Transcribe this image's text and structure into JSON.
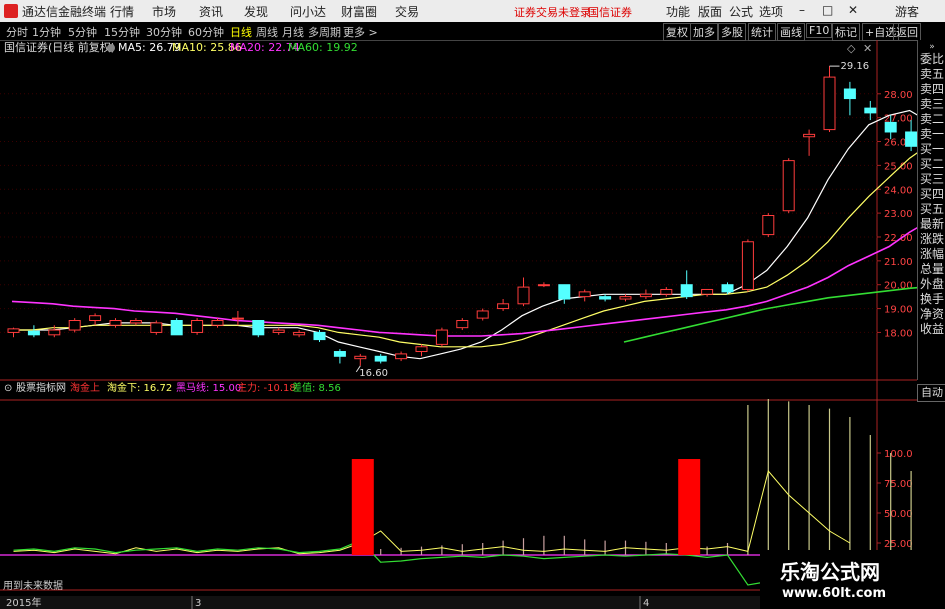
{
  "menu": {
    "app_title": "通达信金融终端",
    "items": [
      "行情",
      "市场",
      "资讯",
      "发现",
      "问小达",
      "财富圈",
      "交易"
    ],
    "status_left": "证券交易未登录",
    "status_right": "国信证券",
    "right_items": [
      "功能",
      "版面",
      "公式",
      "选项"
    ],
    "guest": "游客"
  },
  "periods": {
    "items": [
      "分时",
      "1分钟",
      "5分钟",
      "15分钟",
      "30分钟",
      "60分钟",
      "日线",
      "周线",
      "月线",
      "多周期",
      "更多 >"
    ],
    "selected": "日线"
  },
  "toolbar_right": [
    "复权",
    "加多",
    "多股",
    "统计",
    "画线",
    "F10",
    "标记",
    "+自选",
    "返回"
  ],
  "right_panel": {
    "items": [
      "委比",
      "卖五",
      "卖四",
      "卖三",
      "卖二",
      "卖一",
      "买一",
      "买二",
      "买三",
      "买四",
      "买五",
      "最新",
      "涨跌",
      "涨幅",
      "总量",
      "外盘",
      "换手",
      "净资",
      "收益"
    ],
    "auto_label": "自动"
  },
  "price_header": {
    "stock": "国信证券(日线 前复权)",
    "ma5": "MA5: 26.79",
    "ma10": "MA10: 25.86",
    "ma20": "MA20: 22.74",
    "ma60": "MA60: 19.92"
  },
  "price_axis_labels": [
    "28.00",
    "27.00",
    "26.00",
    "25.00",
    "24.00",
    "23.00",
    "22.00",
    "21.00",
    "20.00",
    "19.00",
    "18.00"
  ],
  "annotations": {
    "high": "29.16",
    "low": "16.60"
  },
  "indicator_header": {
    "name": "股票指标网",
    "taojin_up": "淘金上",
    "taojin_down": "淘金下: 16.72",
    "heima": "黑马线: 15.00",
    "zhuli": "主力: -10.18",
    "chazhi": "差值: 8.56"
  },
  "indicator_axis_labels": [
    "100.0",
    "75.00",
    "50.00",
    "25.00"
  ],
  "footer": {
    "note": "用到未来数据",
    "date_left": "2015年",
    "mark3": "3",
    "mark4": "4"
  },
  "watermark": {
    "line1": "乐淘公式网",
    "line2": "www.60lt.com"
  },
  "colors": {
    "up": "#ff3c3c",
    "down": "#54ffff",
    "ma5": "#ffffff",
    "ma10": "#ffff66",
    "ma20": "#ff33ff",
    "ma60": "#33dd33",
    "signal": "#ff0000"
  },
  "chart_data": {
    "type": "candlestick",
    "price_range": [
      16.3,
      29.5
    ],
    "candles": [
      [
        18.0,
        18.15,
        18.2,
        17.8
      ],
      [
        18.05,
        17.9,
        18.3,
        17.8
      ],
      [
        17.9,
        18.1,
        18.3,
        17.8
      ],
      [
        18.1,
        18.5,
        18.6,
        18.0
      ],
      [
        18.5,
        18.7,
        18.8,
        18.3
      ],
      [
        18.3,
        18.5,
        18.6,
        18.2
      ],
      [
        18.4,
        18.5,
        18.6,
        18.3
      ],
      [
        18.0,
        18.4,
        18.5,
        17.9
      ],
      [
        18.5,
        17.9,
        18.6,
        17.9
      ],
      [
        18.0,
        18.5,
        18.6,
        17.9
      ],
      [
        18.3,
        18.5,
        18.6,
        18.2
      ],
      [
        18.6,
        18.6,
        18.9,
        18.3
      ],
      [
        18.5,
        17.9,
        18.5,
        17.8
      ],
      [
        18.0,
        18.1,
        18.2,
        17.9
      ],
      [
        17.9,
        18.0,
        18.1,
        17.8
      ],
      [
        18.0,
        17.7,
        18.1,
        17.6
      ],
      [
        17.2,
        17.0,
        17.3,
        16.7
      ],
      [
        16.9,
        17.0,
        17.1,
        16.6
      ],
      [
        17.0,
        16.8,
        17.1,
        16.7
      ],
      [
        16.9,
        17.1,
        17.2,
        16.8
      ],
      [
        17.2,
        17.4,
        17.5,
        17.0
      ],
      [
        17.5,
        18.1,
        18.2,
        17.4
      ],
      [
        18.2,
        18.5,
        18.6,
        18.1
      ],
      [
        18.6,
        18.9,
        19.0,
        18.5
      ],
      [
        19.0,
        19.2,
        19.4,
        18.9
      ],
      [
        19.2,
        19.9,
        20.3,
        19.1
      ],
      [
        20.0,
        20.0,
        20.1,
        19.9
      ],
      [
        20.0,
        19.4,
        20.0,
        19.2
      ],
      [
        19.5,
        19.7,
        19.8,
        19.3
      ],
      [
        19.5,
        19.4,
        19.6,
        19.3
      ],
      [
        19.4,
        19.5,
        19.6,
        19.3
      ],
      [
        19.5,
        19.6,
        19.8,
        19.4
      ],
      [
        19.6,
        19.8,
        19.9,
        19.5
      ],
      [
        20.0,
        19.5,
        20.6,
        19.4
      ],
      [
        19.6,
        19.8,
        19.8,
        19.5
      ],
      [
        20.0,
        19.7,
        20.1,
        19.6
      ],
      [
        19.8,
        21.8,
        21.9,
        19.7
      ],
      [
        22.1,
        22.9,
        23.0,
        22.0
      ],
      [
        23.1,
        25.2,
        25.3,
        23.0
      ],
      [
        26.2,
        26.3,
        26.5,
        25.4
      ],
      [
        26.5,
        28.7,
        29.16,
        26.4
      ],
      [
        28.2,
        27.8,
        28.5,
        27.1
      ],
      [
        27.4,
        27.2,
        27.7,
        26.9
      ],
      [
        26.8,
        26.4,
        27.1,
        26.1
      ],
      [
        26.4,
        25.8,
        26.9,
        25.6
      ],
      [
        26.8,
        26.9,
        28.2,
        26.6
      ]
    ],
    "ma_series": [
      {
        "name": "MA5",
        "values": [
          18.1,
          18.1,
          18.1,
          18.2,
          18.3,
          18.4,
          18.4,
          18.4,
          18.3,
          18.3,
          18.3,
          18.3,
          18.2,
          18.2,
          18.2,
          18.0,
          17.6,
          17.4,
          17.2,
          17.0,
          16.9,
          17.1,
          17.3,
          17.6,
          18.1,
          18.7,
          19.1,
          19.4,
          19.5,
          19.6,
          19.6,
          19.6,
          19.6,
          19.6,
          19.6,
          19.6,
          20.0,
          20.6,
          21.6,
          22.8,
          24.4,
          25.7,
          26.7,
          27.1,
          27.3,
          26.8
        ]
      },
      {
        "name": "MA10",
        "values": [
          18.1,
          18.1,
          18.2,
          18.2,
          18.3,
          18.3,
          18.3,
          18.3,
          18.3,
          18.3,
          18.3,
          18.3,
          18.3,
          18.3,
          18.3,
          18.2,
          18.0,
          17.9,
          17.8,
          17.6,
          17.5,
          17.4,
          17.4,
          17.4,
          17.5,
          17.7,
          18.0,
          18.3,
          18.6,
          18.9,
          19.1,
          19.3,
          19.4,
          19.5,
          19.6,
          19.6,
          19.7,
          19.9,
          20.4,
          21.0,
          21.8,
          22.8,
          23.7,
          24.5,
          25.3,
          25.9
        ]
      },
      {
        "name": "MA20",
        "values": [
          19.3,
          19.25,
          19.2,
          19.1,
          19.05,
          19.0,
          18.9,
          18.85,
          18.8,
          18.7,
          18.6,
          18.5,
          18.45,
          18.4,
          18.35,
          18.3,
          18.2,
          18.1,
          18.0,
          17.95,
          17.9,
          17.85,
          17.85,
          17.85,
          17.9,
          17.95,
          18.05,
          18.15,
          18.25,
          18.35,
          18.45,
          18.55,
          18.65,
          18.75,
          18.85,
          18.95,
          19.1,
          19.3,
          19.6,
          19.9,
          20.3,
          20.8,
          21.2,
          21.6,
          22.2,
          22.7
        ]
      },
      {
        "name": "MA60",
        "values": [
          null,
          null,
          null,
          null,
          null,
          null,
          null,
          null,
          null,
          null,
          null,
          null,
          null,
          null,
          null,
          null,
          null,
          null,
          null,
          null,
          null,
          null,
          null,
          null,
          null,
          null,
          null,
          null,
          null,
          null,
          17.6,
          17.8,
          18.0,
          18.2,
          18.4,
          18.6,
          18.8,
          19.0,
          19.15,
          19.3,
          19.45,
          19.55,
          19.65,
          19.75,
          19.85,
          19.92
        ]
      }
    ],
    "indicator": {
      "range": [
        -10,
        140
      ],
      "signals": [
        17,
        33
      ],
      "signal_value": 80,
      "vlines": [
        0,
        0,
        0,
        0,
        0,
        0,
        0,
        0,
        0,
        0,
        0,
        0,
        0,
        0,
        0,
        0,
        0,
        0,
        5,
        6,
        7,
        8,
        9,
        10,
        12,
        14,
        16,
        16,
        13,
        12,
        12,
        11,
        10,
        8,
        7,
        10,
        125,
        130,
        128,
        125,
        122,
        115,
        100,
        85,
        70,
        40,
        20
      ],
      "line_yellow": [
        3,
        4,
        2,
        5,
        3,
        1,
        6,
        3,
        5,
        2,
        4,
        3,
        5,
        6,
        1,
        2,
        4,
        10,
        20,
        3,
        4,
        6,
        3,
        5,
        7,
        4,
        3,
        5,
        4,
        3,
        6,
        5,
        4,
        6,
        5,
        7,
        3,
        70,
        50,
        35,
        20,
        10
      ],
      "line_green": [
        4,
        5,
        3,
        6,
        5,
        2,
        4,
        5,
        6,
        3,
        5,
        4,
        6,
        5,
        2,
        3,
        5,
        12,
        -6,
        -5,
        -3,
        -2,
        -1,
        -2,
        0,
        -1,
        -3,
        -2,
        -1,
        0,
        -1,
        0,
        1,
        0,
        -2,
        0,
        -25,
        -22,
        -20,
        -16,
        -14
      ]
    }
  }
}
